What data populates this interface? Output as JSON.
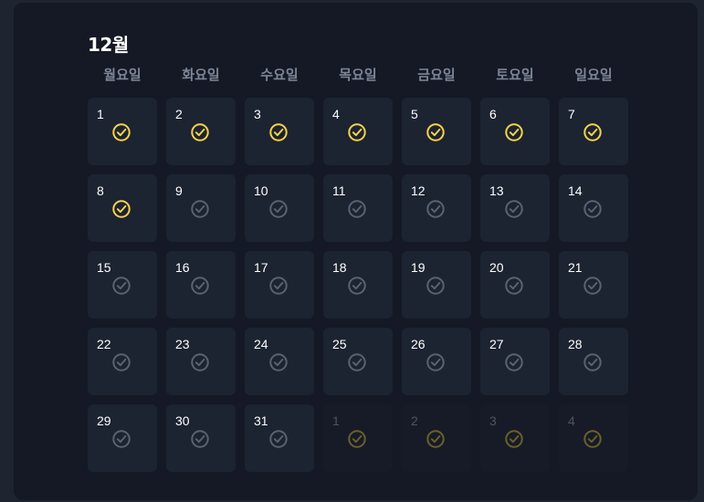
{
  "calendar": {
    "month_title": "12월",
    "weekdays": [
      "월요일",
      "화요일",
      "수요일",
      "목요일",
      "금요일",
      "토요일",
      "일요일"
    ],
    "colors": {
      "checked": "#f5d24a",
      "unchecked": "#5a6170",
      "next_month_checked": "#6b5f2b"
    },
    "days": [
      {
        "label": "1",
        "status": "checked",
        "in_month": true
      },
      {
        "label": "2",
        "status": "checked",
        "in_month": true
      },
      {
        "label": "3",
        "status": "checked",
        "in_month": true
      },
      {
        "label": "4",
        "status": "checked",
        "in_month": true
      },
      {
        "label": "5",
        "status": "checked",
        "in_month": true
      },
      {
        "label": "6",
        "status": "checked",
        "in_month": true
      },
      {
        "label": "7",
        "status": "checked",
        "in_month": true
      },
      {
        "label": "8",
        "status": "checked",
        "in_month": true
      },
      {
        "label": "9",
        "status": "unchecked",
        "in_month": true
      },
      {
        "label": "10",
        "status": "unchecked",
        "in_month": true
      },
      {
        "label": "11",
        "status": "unchecked",
        "in_month": true
      },
      {
        "label": "12",
        "status": "unchecked",
        "in_month": true
      },
      {
        "label": "13",
        "status": "unchecked",
        "in_month": true
      },
      {
        "label": "14",
        "status": "unchecked",
        "in_month": true
      },
      {
        "label": "15",
        "status": "unchecked",
        "in_month": true
      },
      {
        "label": "16",
        "status": "unchecked",
        "in_month": true
      },
      {
        "label": "17",
        "status": "unchecked",
        "in_month": true
      },
      {
        "label": "18",
        "status": "unchecked",
        "in_month": true
      },
      {
        "label": "19",
        "status": "unchecked",
        "in_month": true
      },
      {
        "label": "20",
        "status": "unchecked",
        "in_month": true
      },
      {
        "label": "21",
        "status": "unchecked",
        "in_month": true
      },
      {
        "label": "22",
        "status": "unchecked",
        "in_month": true
      },
      {
        "label": "23",
        "status": "unchecked",
        "in_month": true
      },
      {
        "label": "24",
        "status": "unchecked",
        "in_month": true
      },
      {
        "label": "25",
        "status": "unchecked",
        "in_month": true
      },
      {
        "label": "26",
        "status": "unchecked",
        "in_month": true
      },
      {
        "label": "27",
        "status": "unchecked",
        "in_month": true
      },
      {
        "label": "28",
        "status": "unchecked",
        "in_month": true
      },
      {
        "label": "29",
        "status": "unchecked",
        "in_month": true
      },
      {
        "label": "30",
        "status": "unchecked",
        "in_month": true
      },
      {
        "label": "31",
        "status": "unchecked",
        "in_month": true
      },
      {
        "label": "1",
        "status": "checked",
        "in_month": false
      },
      {
        "label": "2",
        "status": "checked",
        "in_month": false
      },
      {
        "label": "3",
        "status": "checked",
        "in_month": false
      },
      {
        "label": "4",
        "status": "checked",
        "in_month": false
      }
    ],
    "icon": "check-circle-icon"
  }
}
